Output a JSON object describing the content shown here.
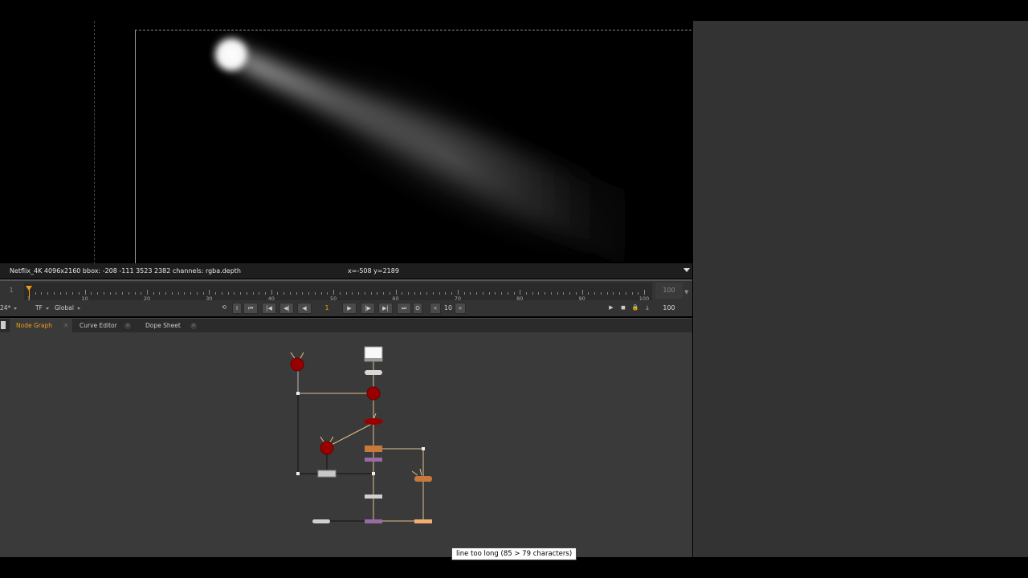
{
  "viewer": {
    "info": {
      "format": "Netflix_4K 4096x2160  bbox: -208 -111 3523 2382 channels: rgba.depth",
      "coords": "x=-508 y=2189"
    }
  },
  "timeline": {
    "start_frame": "1",
    "end_frame": "100",
    "ticks": [
      {
        "label": "1",
        "frame": 1
      },
      {
        "label": "10",
        "frame": 10
      },
      {
        "label": "20",
        "frame": 20
      },
      {
        "label": "30",
        "frame": 30
      },
      {
        "label": "40",
        "frame": 40
      },
      {
        "label": "50",
        "frame": 50
      },
      {
        "label": "60",
        "frame": 60
      },
      {
        "label": "70",
        "frame": 70
      },
      {
        "label": "80",
        "frame": 80
      },
      {
        "label": "90",
        "frame": 90
      },
      {
        "label": "100",
        "frame": 100
      }
    ],
    "current_frame": "1",
    "fps": "24*",
    "tf": "TF",
    "range": "Global",
    "increment": "10",
    "out_frame": "100",
    "buttons": {
      "in": "I",
      "out": "O"
    }
  },
  "tabs": [
    {
      "label": "Node Graph",
      "active": true
    },
    {
      "label": "Curve Editor",
      "active": false
    },
    {
      "label": "Dope Sheet",
      "active": false
    }
  ],
  "tooltip": "line too long (85 > 79 characters)",
  "colors": {
    "accent": "#f39c12",
    "node_red": "#990000",
    "node_orange": "#c8783a",
    "node_purple": "#9a6aa8",
    "node_gray": "#c8c8c8",
    "pipe_yellow": "#d4a860"
  }
}
